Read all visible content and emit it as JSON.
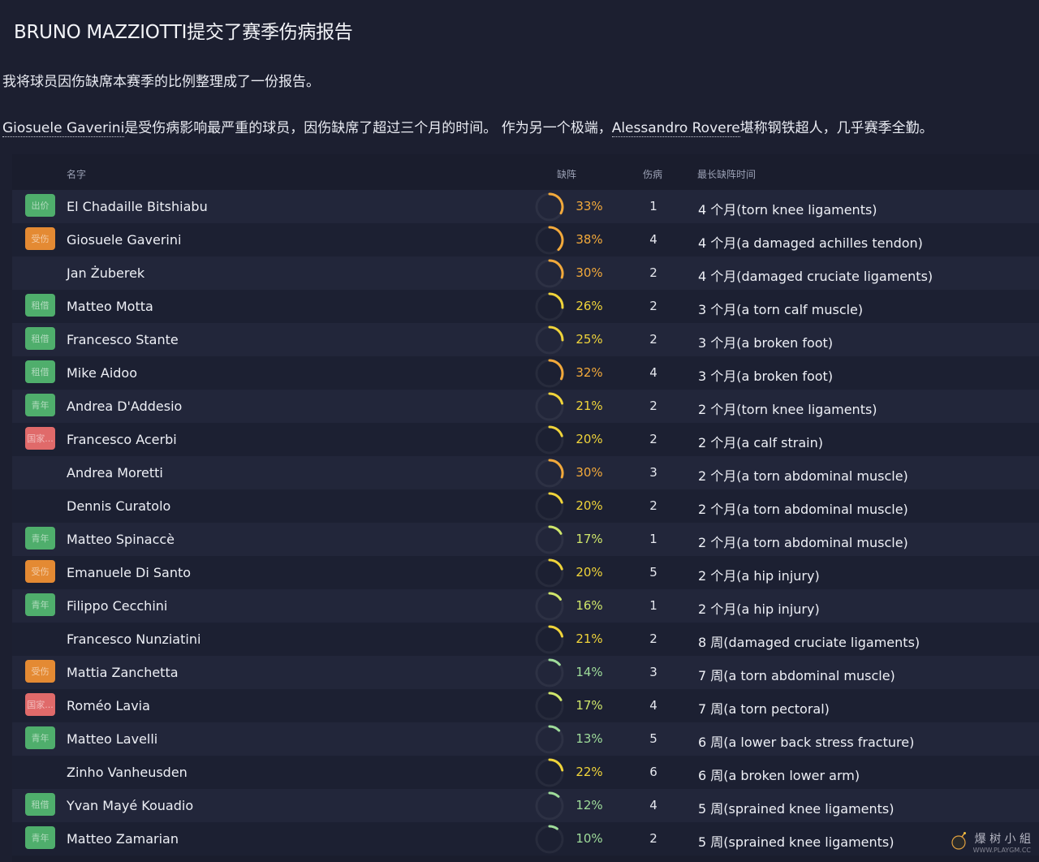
{
  "header": {
    "title": "BRUNO MAZZIOTTI提交了赛季伤病报告"
  },
  "intro": {
    "line1": "我将球员因伤缺席本赛季的比例整理成了一份报告。",
    "line2_player1": "Giosuele Gaverini",
    "line2_mid": "是受伤病影响最严重的球员，因伤缺席了超过三个月的时间。 作为另一个极端，",
    "line2_player2": "Alessandro Rovere",
    "line2_end": "堪称钢铁超人，几乎赛季全勤。"
  },
  "table": {
    "columns": {
      "name": "名字",
      "absence": "缺阵",
      "injuries": "伤病",
      "longest": "最长缺阵时间"
    },
    "rows": [
      {
        "tag": "出价",
        "tag_color": "green",
        "name": "El Chadaille Bitshiabu",
        "pct": "33%",
        "pct_value": 33,
        "injuries": "1",
        "longest": "4 个月(torn knee ligaments)"
      },
      {
        "tag": "受伤",
        "tag_color": "orange",
        "name": "Giosuele Gaverini",
        "pct": "38%",
        "pct_value": 38,
        "injuries": "4",
        "longest": "4 个月(a damaged achilles tendon)"
      },
      {
        "tag": "",
        "tag_color": "none",
        "name": "Jan Żuberek",
        "pct": "30%",
        "pct_value": 30,
        "injuries": "2",
        "longest": "4 个月(damaged cruciate ligaments)"
      },
      {
        "tag": "租借",
        "tag_color": "green",
        "name": "Matteo Motta",
        "pct": "26%",
        "pct_value": 26,
        "injuries": "2",
        "longest": "3 个月(a torn calf muscle)"
      },
      {
        "tag": "租借",
        "tag_color": "green",
        "name": "Francesco Stante",
        "pct": "25%",
        "pct_value": 25,
        "injuries": "2",
        "longest": "3 个月(a broken foot)"
      },
      {
        "tag": "租借",
        "tag_color": "green",
        "name": "Mike Aidoo",
        "pct": "32%",
        "pct_value": 32,
        "injuries": "4",
        "longest": "3 个月(a broken foot)"
      },
      {
        "tag": "青年",
        "tag_color": "green",
        "name": "Andrea D'Addesio",
        "pct": "21%",
        "pct_value": 21,
        "injuries": "2",
        "longest": "2 个月(torn knee ligaments)"
      },
      {
        "tag": "国家...",
        "tag_color": "red",
        "name": "Francesco Acerbi",
        "pct": "20%",
        "pct_value": 20,
        "injuries": "2",
        "longest": "2 个月(a calf strain)"
      },
      {
        "tag": "",
        "tag_color": "none",
        "name": "Andrea Moretti",
        "pct": "30%",
        "pct_value": 30,
        "injuries": "3",
        "longest": "2 个月(a torn abdominal muscle)"
      },
      {
        "tag": "",
        "tag_color": "none",
        "name": "Dennis Curatolo",
        "pct": "20%",
        "pct_value": 20,
        "injuries": "2",
        "longest": "2 个月(a torn abdominal muscle)"
      },
      {
        "tag": "青年",
        "tag_color": "green",
        "name": "Matteo Spinaccè",
        "pct": "17%",
        "pct_value": 17,
        "injuries": "1",
        "longest": "2 个月(a torn abdominal muscle)"
      },
      {
        "tag": "受伤",
        "tag_color": "orange",
        "name": "Emanuele Di Santo",
        "pct": "20%",
        "pct_value": 20,
        "injuries": "5",
        "longest": "2 个月(a hip injury)"
      },
      {
        "tag": "青年",
        "tag_color": "green",
        "name": "Filippo Cecchini",
        "pct": "16%",
        "pct_value": 16,
        "injuries": "1",
        "longest": "2 个月(a hip injury)"
      },
      {
        "tag": "",
        "tag_color": "none",
        "name": "Francesco Nunziatini",
        "pct": "21%",
        "pct_value": 21,
        "injuries": "2",
        "longest": "8 周(damaged cruciate ligaments)"
      },
      {
        "tag": "受伤",
        "tag_color": "orange",
        "name": "Mattia Zanchetta",
        "pct": "14%",
        "pct_value": 14,
        "injuries": "3",
        "longest": "7 周(a torn abdominal muscle)"
      },
      {
        "tag": "国家...",
        "tag_color": "red",
        "name": "Roméo Lavia",
        "pct": "17%",
        "pct_value": 17,
        "injuries": "4",
        "longest": "7 周(a torn pectoral)"
      },
      {
        "tag": "青年",
        "tag_color": "green",
        "name": "Matteo Lavelli",
        "pct": "13%",
        "pct_value": 13,
        "injuries": "5",
        "longest": "6 周(a lower back stress fracture)"
      },
      {
        "tag": "",
        "tag_color": "none",
        "name": "Zinho Vanheusden",
        "pct": "22%",
        "pct_value": 22,
        "injuries": "6",
        "longest": "6 周(a broken lower arm)"
      },
      {
        "tag": "租借",
        "tag_color": "green",
        "name": "Yvan Mayé Kouadio",
        "pct": "12%",
        "pct_value": 12,
        "injuries": "4",
        "longest": "5 周(sprained knee ligaments)"
      },
      {
        "tag": "青年",
        "tag_color": "green",
        "name": "Matteo Zamarian",
        "pct": "10%",
        "pct_value": 10,
        "injuries": "2",
        "longest": "5 周(sprained knee ligaments)"
      }
    ]
  },
  "colors": {
    "tag_green": "#4fae6c",
    "tag_orange": "#e48a33",
    "tag_red": "#e06a6a",
    "gauge_high": "#f2a93b",
    "gauge_mid": "#f0d43a",
    "gauge_low": "#cfe66a",
    "gauge_lowest": "#9fdc9a"
  },
  "watermark": {
    "text": "爆 树 小 組",
    "url": "WWW.PLAYGM.CC"
  }
}
